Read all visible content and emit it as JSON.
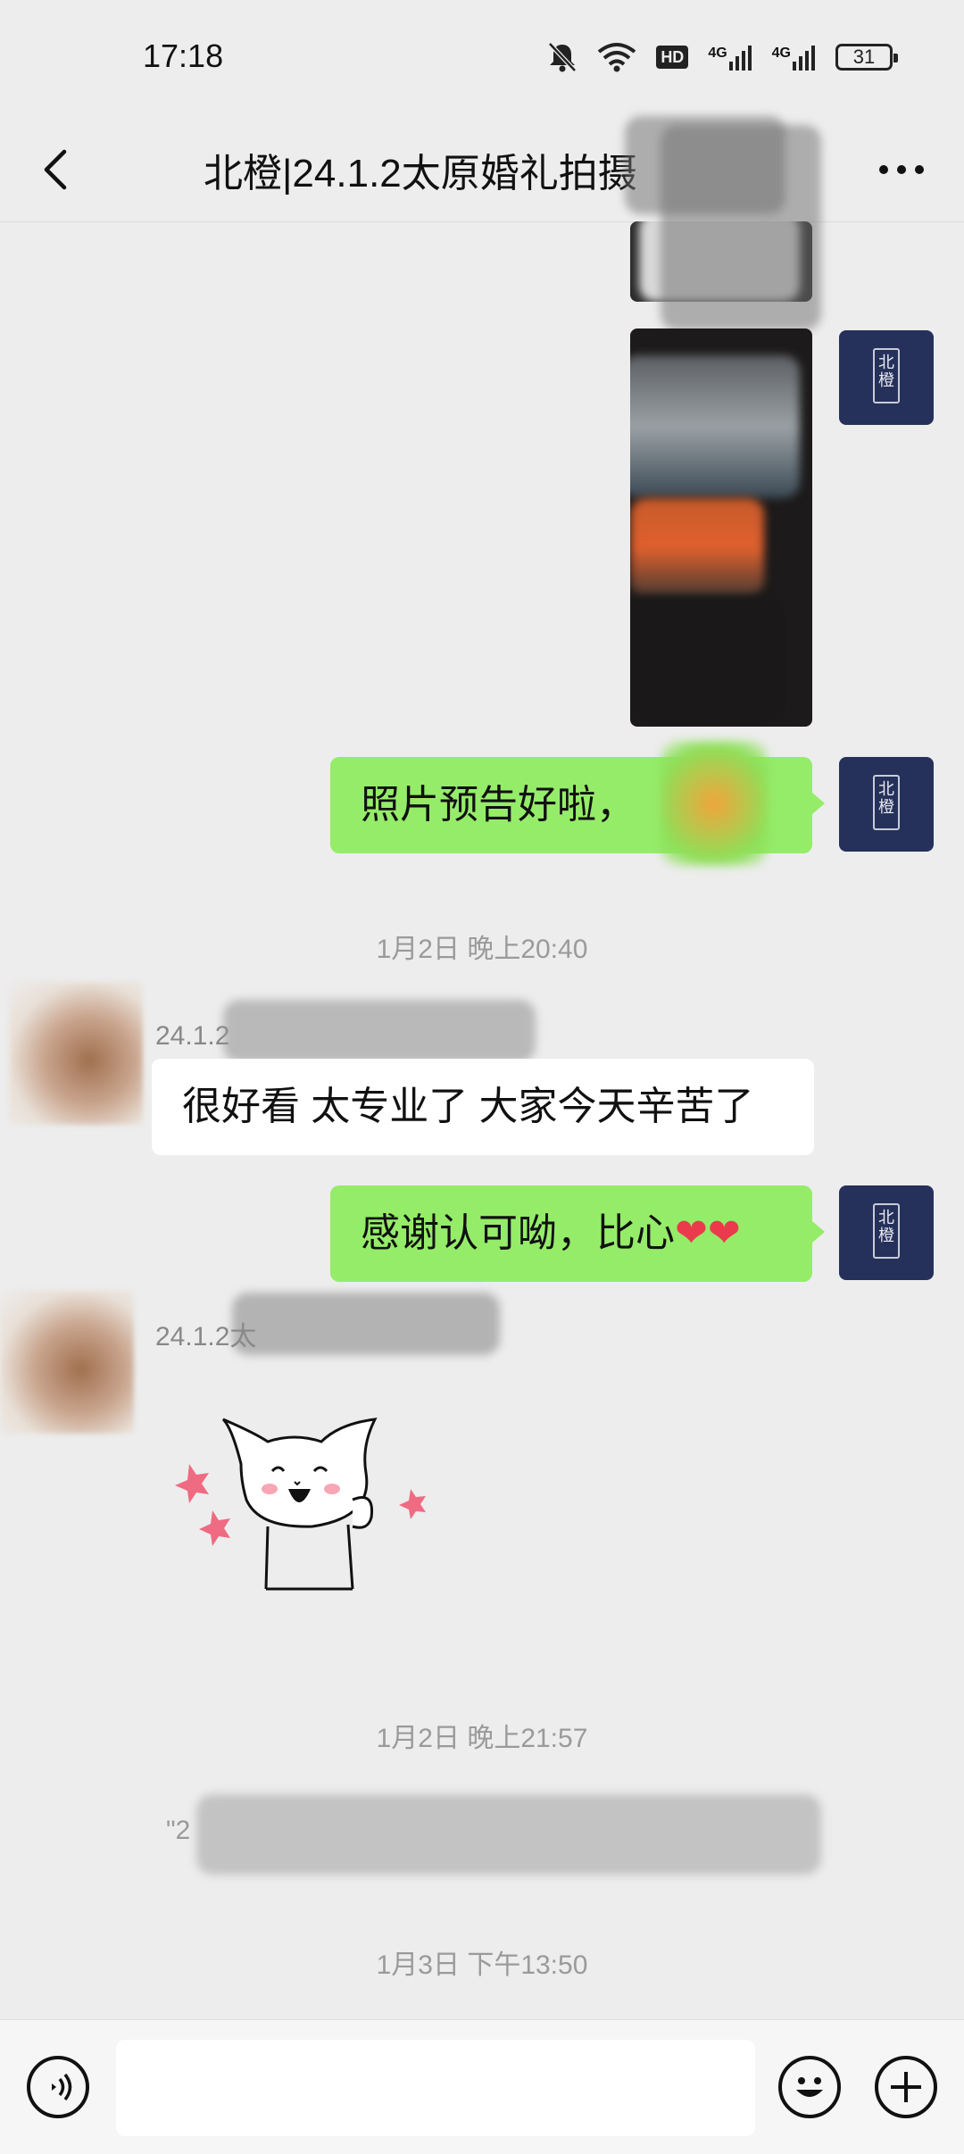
{
  "status": {
    "time": "17:18",
    "hd": "HD",
    "net1": "4G",
    "net2": "4G",
    "battery": "31"
  },
  "header": {
    "title": "北橙|24.1.2太原婚礼拍摄"
  },
  "messages": {
    "m1": "照片预告好啦，",
    "ts1": "1月2日 晚上20:40",
    "sender1": "24.1.2",
    "m2": "很好看 太专业了 大家今天辛苦了",
    "m3": "感谢认可呦，比心",
    "m3_emoji": "❤❤",
    "sender2": "24.1.2太",
    "ts2": "1月2日 晚上21:57",
    "recalled": "\"2",
    "ts3": "1月3日 下午13:50"
  },
  "self_avatar": {
    "mark": "北橙",
    "color": "#25315a"
  },
  "colors": {
    "self_bubble": "#95ec69",
    "other_bubble": "#ffffff",
    "background": "#ededed"
  },
  "icons": [
    "bell-off-icon",
    "wifi-icon",
    "signal-icon",
    "back-icon",
    "more-icon",
    "voice-icon",
    "emoji-icon",
    "plus-icon",
    "cat-sticker"
  ]
}
